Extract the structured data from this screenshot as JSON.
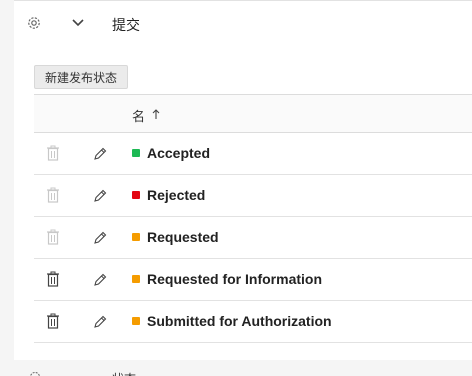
{
  "section": {
    "title": "提交",
    "icons": [
      "gear-icon",
      "chevron-down-icon"
    ]
  },
  "toolbar": {
    "new_status_label": "新建发布状态"
  },
  "table": {
    "column_name": "名",
    "sort": "ascending",
    "rows": [
      {
        "label": "Accepted",
        "color": "#1db954",
        "delete_enabled": false
      },
      {
        "label": "Rejected",
        "color": "#e30613",
        "delete_enabled": false
      },
      {
        "label": "Requested",
        "color": "#f59c00",
        "delete_enabled": false
      },
      {
        "label": "Requested for Information",
        "color": "#f59c00",
        "delete_enabled": true
      },
      {
        "label": "Submitted for Authorization",
        "color": "#f59c00",
        "delete_enabled": true
      }
    ]
  },
  "next_section": {
    "title": "状态"
  }
}
